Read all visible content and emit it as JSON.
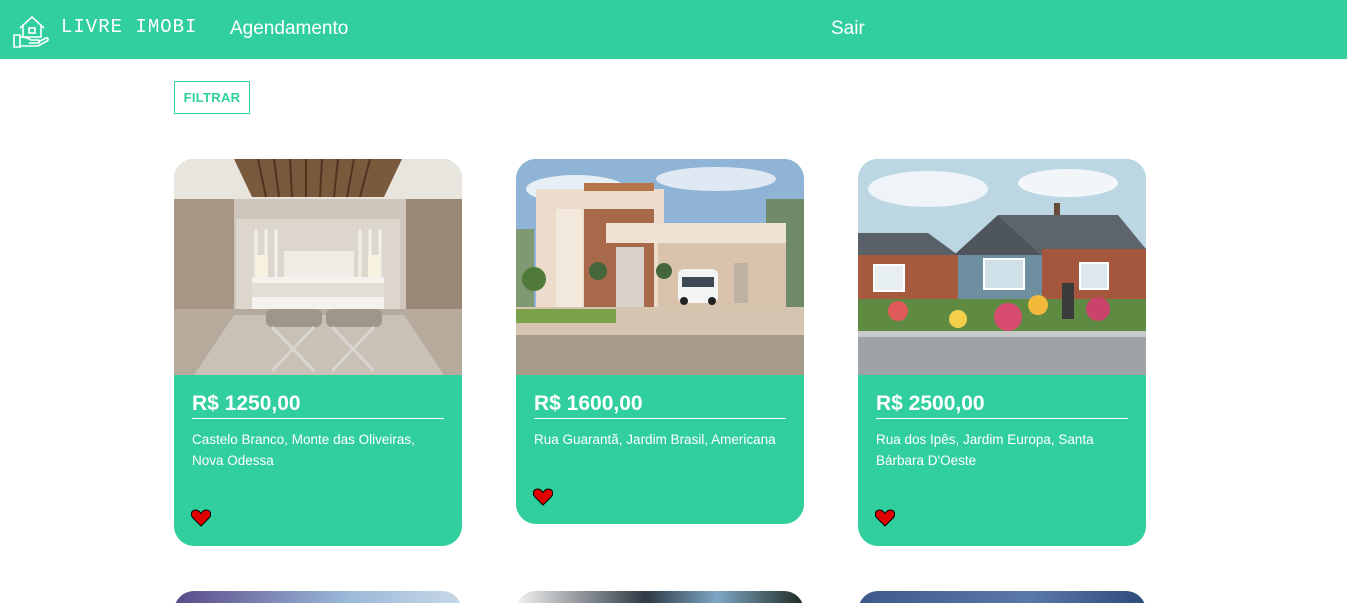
{
  "nav": {
    "brand": "LIVRE IMOBI",
    "logo_icon": "house-hand-icon",
    "links": [
      {
        "label": "Agendamento"
      },
      {
        "label": "Sair"
      }
    ],
    "color": "#31cf9e"
  },
  "filter": {
    "label": "FILTRAR"
  },
  "listings": [
    {
      "price": "R$ 1250,00",
      "address": "Castelo Branco, Monte das Oliveiras, Nova Odessa",
      "image": "bedroom-photo",
      "favorite_icon": "heart-icon"
    },
    {
      "price": "R$ 1600,00",
      "address": "Rua Guarantã, Jardim Brasil, Americana",
      "image": "modern-house-photo",
      "favorite_icon": "heart-icon"
    },
    {
      "price": "R$ 2500,00",
      "address": "Rua dos Ipês, Jardim Europa, Santa Bárbara D'Oeste",
      "image": "brick-bungalow-photo",
      "favorite_icon": "heart-icon"
    }
  ],
  "colors": {
    "accent": "#31cf9e",
    "heart": "#e00000"
  }
}
